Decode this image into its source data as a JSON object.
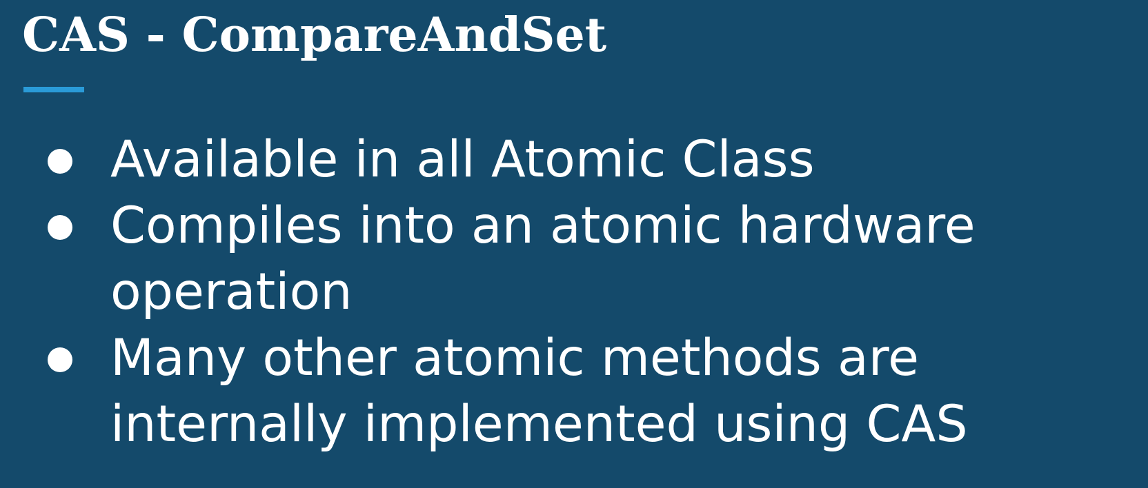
{
  "slide": {
    "title": "CAS - CompareAndSet",
    "accent_color": "#2a9bd8",
    "background_color": "#144a6b",
    "bullets": [
      {
        "lines": [
          "Available in all Atomic Class"
        ]
      },
      {
        "lines": [
          "Compiles into an atomic hardware",
          "operation"
        ]
      },
      {
        "lines": [
          "Many other atomic methods are",
          "internally implemented using CAS"
        ]
      }
    ]
  }
}
